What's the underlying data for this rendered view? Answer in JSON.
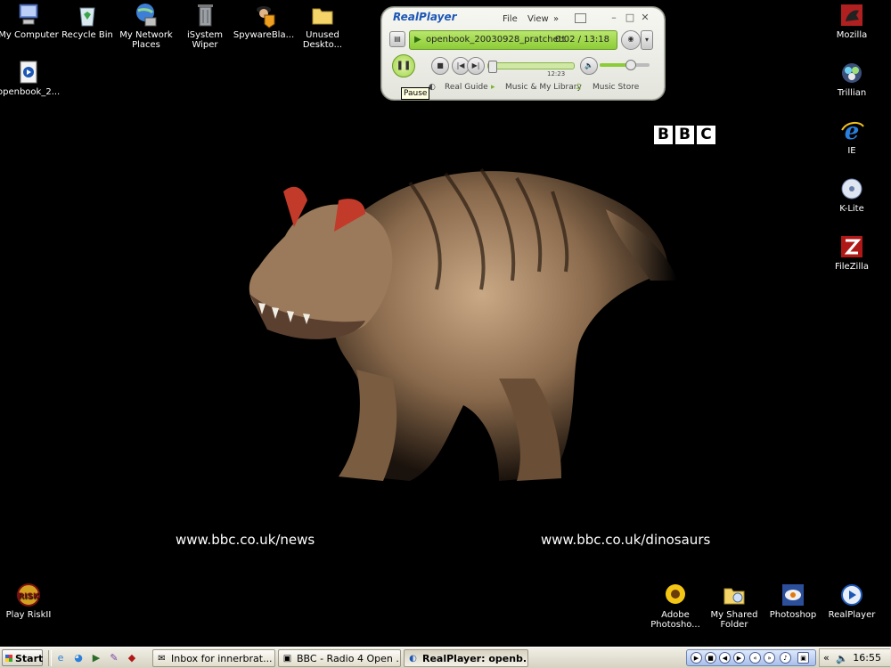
{
  "desktop_icons_top": [
    {
      "label": "My Computer"
    },
    {
      "label": "Recycle Bin"
    },
    {
      "label": "My Network Places"
    },
    {
      "label": "iSystem Wiper"
    },
    {
      "label": "SpywareBla..."
    },
    {
      "label": "Unused Deskto..."
    }
  ],
  "desktop_icon_openbook": {
    "label": "openbook_2..."
  },
  "desktop_icons_right": [
    {
      "label": "Mozilla"
    },
    {
      "label": "Trillian"
    },
    {
      "label": "IE"
    },
    {
      "label": "K-Lite"
    },
    {
      "label": "FileZilla"
    }
  ],
  "desktop_icons_bottom": [
    {
      "label": "Play RiskII"
    },
    {
      "label": "Adobe Photosho..."
    },
    {
      "label": "My Shared Folder"
    },
    {
      "label": "Photoshop"
    },
    {
      "label": "RealPlayer"
    }
  ],
  "wallpaper": {
    "logo_letters": [
      "B",
      "B",
      "C"
    ],
    "link_left": "www.bbc.co.uk/news",
    "link_right": "www.bbc.co.uk/dinosaurs"
  },
  "realplayer": {
    "brand": "RealPlayer",
    "menu_file": "File",
    "menu_view": "View",
    "menu_more": "»",
    "clip_name": "openbook_20030928_pratchett",
    "time": "0:02 / 13:18",
    "seek_time": "12:23",
    "nav_real_guide": "Real Guide",
    "nav_music_library": "Music & My Library",
    "nav_music_store": "Music Store",
    "tooltip": "Pause",
    "position_fraction": 0.003,
    "volume_fraction": 0.6,
    "accent_green": "#8ccc36"
  },
  "taskbar": {
    "start_label": "Start",
    "tasks": [
      {
        "label": "Inbox for innerbrat..."
      },
      {
        "label": "BBC - Radio 4 Open ..."
      },
      {
        "label": "RealPlayer: openb..."
      }
    ],
    "tray_expand": "«",
    "clock": "16:55"
  }
}
